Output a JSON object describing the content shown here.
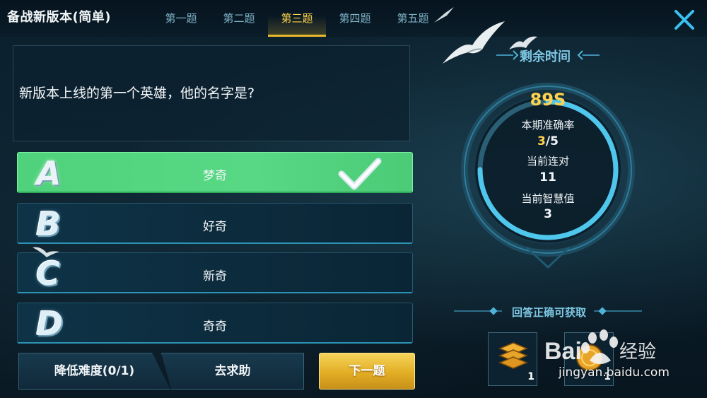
{
  "header": {
    "title": "备战新版本(简单)",
    "tabs": [
      {
        "label": "第一题",
        "active": false
      },
      {
        "label": "第二题",
        "active": false
      },
      {
        "label": "第三题",
        "active": true
      },
      {
        "label": "第四题",
        "active": false
      },
      {
        "label": "第五题",
        "active": false
      }
    ],
    "close_icon": "close-icon"
  },
  "question": {
    "text": "新版本上线的第一个英雄，他的名字是?"
  },
  "options": [
    {
      "letter": "A",
      "text": "梦奇",
      "state": "correct"
    },
    {
      "letter": "B",
      "text": "好奇",
      "state": "default"
    },
    {
      "letter": "C",
      "text": "新奇",
      "state": "default"
    },
    {
      "letter": "D",
      "text": "奇奇",
      "state": "default"
    }
  ],
  "actions": {
    "lower_difficulty": "降低难度(0/1)",
    "ask_help": "去求助",
    "next": "下一题"
  },
  "panel": {
    "timer_title": "剩余时间",
    "time_left": "89S",
    "time_remaining_fraction": 0.75,
    "accuracy_label": "本期准确率",
    "accuracy_correct": "3",
    "accuracy_total": "/5",
    "streak_label": "当前连对",
    "streak_value": "11",
    "wisdom_label": "当前智慧值",
    "wisdom_value": "3",
    "reward_title": "回答正确可获取",
    "rewards": [
      {
        "icon": "coin-stack-icon",
        "count": "1"
      },
      {
        "icon": "gold-coin-icon",
        "count": "1"
      }
    ]
  },
  "watermark": {
    "logo": "Bai 经验",
    "url": "jingyan.baidu.com"
  },
  "colors": {
    "accent_gold": "#ffd34d",
    "correct_green": "#55d680",
    "panel_cyan": "#7fc9e6"
  }
}
